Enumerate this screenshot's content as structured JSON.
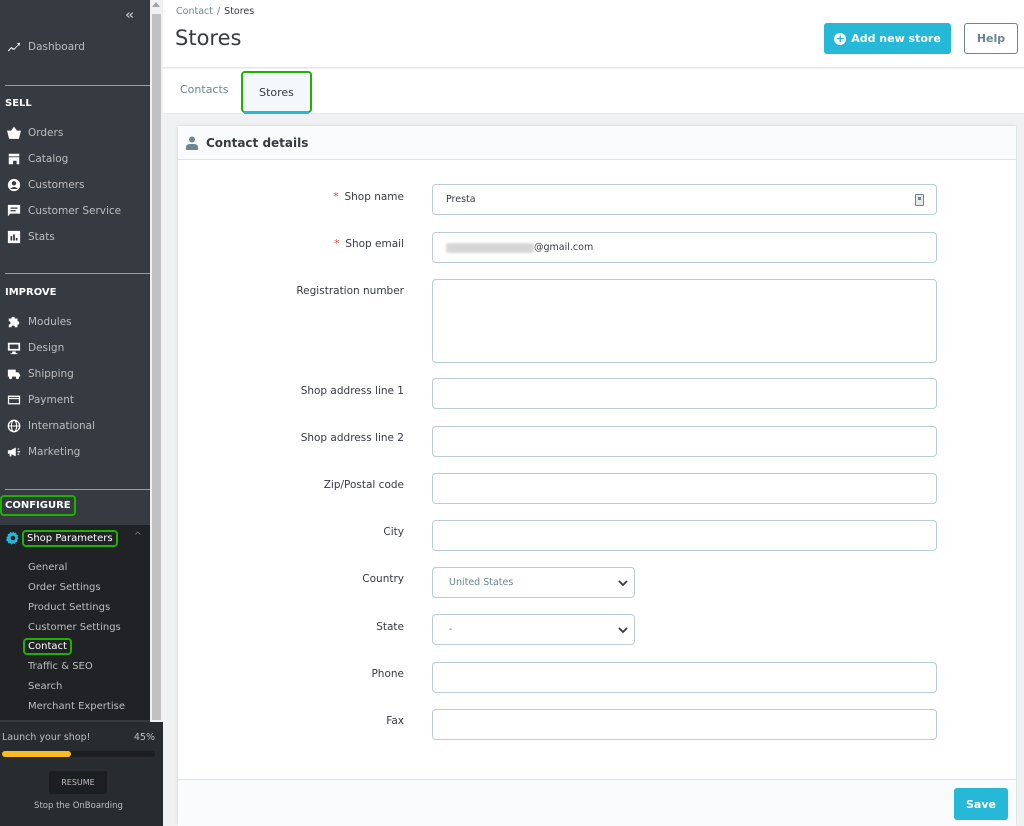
{
  "sidebar": {
    "collapse_label": "‹‹",
    "dashboard": "Dashboard",
    "sections": {
      "sell": "SELL",
      "improve": "IMPROVE",
      "configure": "CONFIGURE"
    },
    "sell_items": [
      {
        "label": "Orders",
        "icon": "basket-icon"
      },
      {
        "label": "Catalog",
        "icon": "store-icon"
      },
      {
        "label": "Customers",
        "icon": "account-circle-icon"
      },
      {
        "label": "Customer Service",
        "icon": "chat-icon"
      },
      {
        "label": "Stats",
        "icon": "bar-chart-icon"
      }
    ],
    "improve_items": [
      {
        "label": "Modules",
        "icon": "puzzle-icon"
      },
      {
        "label": "Design",
        "icon": "desktop-icon"
      },
      {
        "label": "Shipping",
        "icon": "truck-icon"
      },
      {
        "label": "Payment",
        "icon": "credit-card-icon"
      },
      {
        "label": "International",
        "icon": "globe-icon"
      },
      {
        "label": "Marketing",
        "icon": "megaphone-icon"
      }
    ],
    "shop_parameters": {
      "label": "Shop Parameters",
      "caret": "^",
      "sub_items": [
        "General",
        "Order Settings",
        "Product Settings",
        "Customer Settings",
        "Contact",
        "Traffic & SEO",
        "Search",
        "Merchant Expertise"
      ],
      "active": "Contact"
    },
    "onboarding": {
      "title": "Launch your shop!",
      "percent_label": "45%",
      "progress": 0.45,
      "resume_label": "RESUME",
      "stop_label": "Stop the OnBoarding"
    }
  },
  "header": {
    "breadcrumb": [
      "Contact",
      "Stores"
    ],
    "breadcrumb_sep": "/",
    "title": "Stores",
    "add_button": "Add new store",
    "help_button": "Help"
  },
  "tabs": [
    {
      "label": "Contacts",
      "active": false
    },
    {
      "label": "Stores",
      "active": true
    }
  ],
  "card": {
    "title": "Contact details",
    "fields": {
      "shop_name": {
        "label": "Shop name",
        "required": true,
        "value": "Presta"
      },
      "shop_email": {
        "label": "Shop email",
        "required": true,
        "value": "@gmail.com"
      },
      "registration_number": {
        "label": "Registration number",
        "value": ""
      },
      "address1": {
        "label": "Shop address line 1",
        "value": ""
      },
      "address2": {
        "label": "Shop address line 2",
        "value": ""
      },
      "zip": {
        "label": "Zip/Postal code",
        "value": ""
      },
      "city": {
        "label": "City",
        "value": ""
      },
      "country": {
        "label": "Country",
        "value": "United States"
      },
      "state": {
        "label": "State",
        "value": "-"
      },
      "phone": {
        "label": "Phone",
        "value": ""
      },
      "fax": {
        "label": "Fax",
        "value": ""
      }
    },
    "required_mark": "*",
    "save_button": "Save"
  },
  "colors": {
    "accent": "#25b9d7",
    "sidebar_bg": "#363a41",
    "highlight": "#1fb100",
    "progress": "#fbbb22",
    "required": "#f54c3e"
  }
}
